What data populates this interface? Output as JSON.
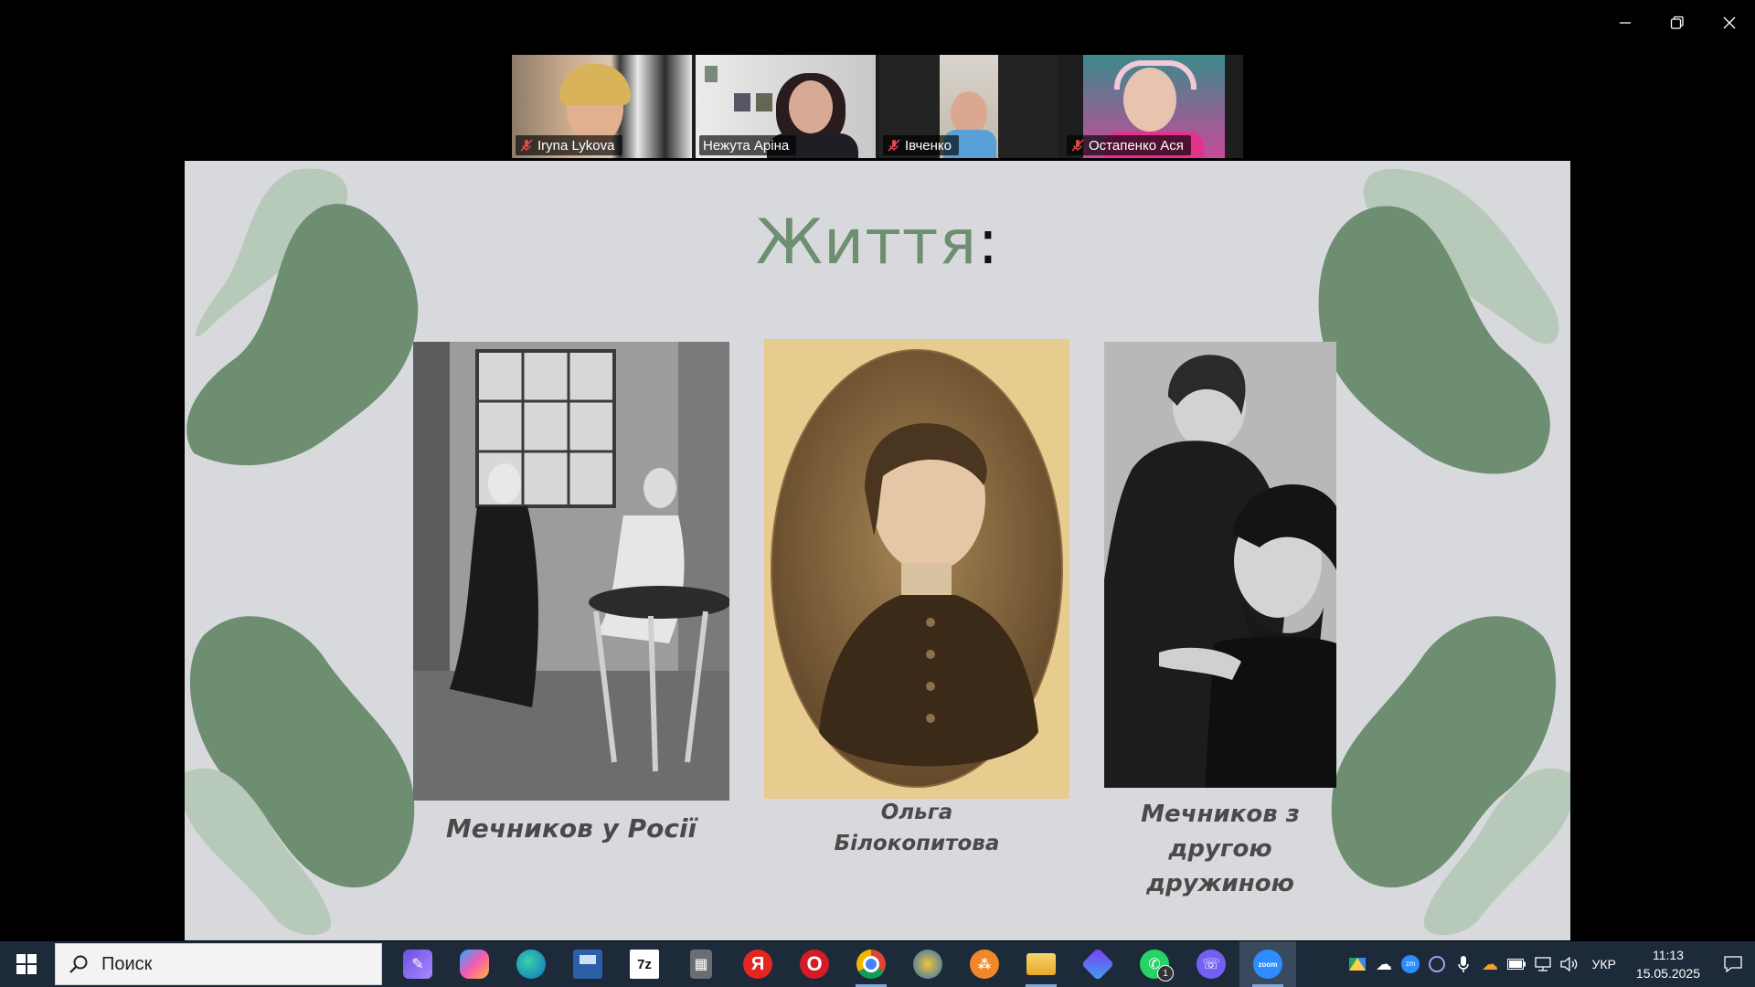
{
  "participants": [
    {
      "name": "Iryna Lykova",
      "muted": true,
      "active": false
    },
    {
      "name": "Нежута Аріна",
      "muted": false,
      "active": true
    },
    {
      "name": "Івченко",
      "muted": true,
      "active": false
    },
    {
      "name": "Остапенко Ася",
      "muted": true,
      "active": false
    }
  ],
  "slide": {
    "title": "Життя",
    "title_suffix": ":",
    "captions": [
      "Мечников у Росії",
      "Ольга\nБілокопитова",
      "Мечников з другою\nдружиною"
    ]
  },
  "colors": {
    "slide_bg": "#d8d9dd",
    "blob_dark": "#6e8e72",
    "blob_light": "#b7c9b8",
    "active_border": "#2ddf8c",
    "taskbar_bg": "#1d2a3a"
  },
  "taskbar": {
    "search_placeholder": "Поиск",
    "apps": [
      {
        "name": "Zoom board",
        "icon": "pen-app-icon"
      },
      {
        "name": "Copilot",
        "icon": "copilot-icon"
      },
      {
        "name": "Microsoft Edge",
        "icon": "edge-icon"
      },
      {
        "name": "Save",
        "icon": "floppy-icon"
      },
      {
        "name": "7-Zip",
        "icon": "7zip-icon",
        "text": "7z"
      },
      {
        "name": "Calculator",
        "icon": "calculator-icon"
      },
      {
        "name": "Yandex",
        "icon": "yandex-icon",
        "text": "Я"
      },
      {
        "name": "Opera",
        "icon": "opera-icon",
        "text": "O"
      },
      {
        "name": "Chrome",
        "icon": "chrome-icon"
      },
      {
        "name": "Browser",
        "icon": "round-browser-icon"
      },
      {
        "name": "Network",
        "icon": "network-app-icon"
      },
      {
        "name": "File Explorer",
        "icon": "folder-icon"
      },
      {
        "name": "Gradient app",
        "icon": "cube-app-icon"
      },
      {
        "name": "WhatsApp",
        "icon": "whatsapp-icon",
        "badge": "1"
      },
      {
        "name": "Viber",
        "icon": "viber-icon"
      },
      {
        "name": "Zoom",
        "icon": "zoom-icon",
        "text": "zoom"
      }
    ],
    "language": "УКР",
    "time": "11:13",
    "date": "15.05.2025"
  }
}
